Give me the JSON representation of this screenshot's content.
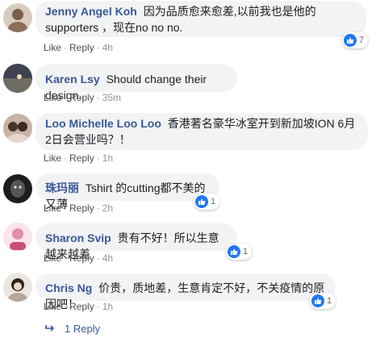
{
  "comments": [
    {
      "author": "Jenny Angel Koh",
      "text": "因为品质愈来愈差,以前我也是他的supporters ，现在no no no.",
      "like": "Like",
      "reply": "Reply",
      "time": "4h",
      "reactions": "7",
      "avatar_color": "#c9b8a6"
    },
    {
      "author": "Karen Lsy",
      "text": "Should change their design..",
      "like": "Like",
      "reply": "Reply",
      "time": "35m",
      "reactions": "",
      "avatar_color": "#6b6f7a"
    },
    {
      "author": "Loo Michelle Loo Loo",
      "text": "香港著名豪华冰室开到新加坡ION 6月2日会营业吗？！",
      "like": "Like",
      "reply": "Reply",
      "time": "1h",
      "reactions": "",
      "avatar_color": "#b89a86"
    },
    {
      "author": "珠玛丽",
      "text": "Tshirt 的cutting都不美的又薄",
      "like": "Like",
      "reply": "Reply",
      "time": "2h",
      "reactions": "1",
      "avatar_color": "#2a2a2a"
    },
    {
      "author": "Sharon Svip",
      "text": "贵有不好！所以生意越来越差",
      "like": "Like",
      "reply": "Reply",
      "time": "4h",
      "reactions": "1",
      "avatar_color": "#e7b9c7"
    },
    {
      "author": "Chris Ng",
      "text": "价贵，质地差，生意肯定不好，不关疫情的原因吧！",
      "like": "Like",
      "reply": "Reply",
      "time": "1h",
      "reactions": "1",
      "avatar_color": "#d9cbbf"
    }
  ],
  "view_replies": "1 Reply",
  "colors": {
    "author": "#385898",
    "bubble": "#f2f3f5",
    "like_badge": "#2078f4",
    "meta": "#90949c"
  }
}
